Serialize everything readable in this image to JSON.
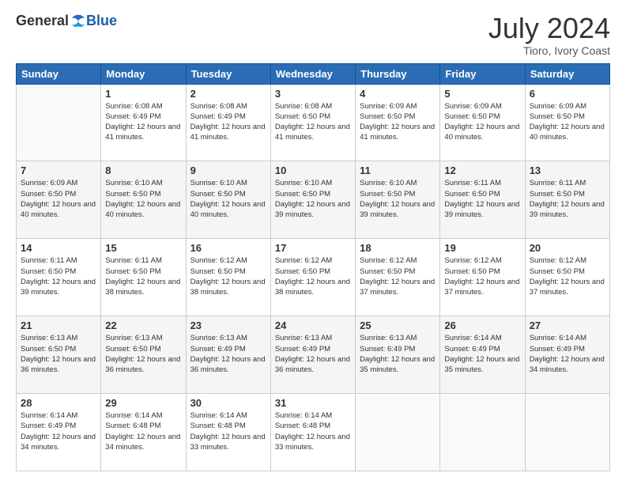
{
  "header": {
    "logo_general": "General",
    "logo_blue": "Blue",
    "month_title": "July 2024",
    "subtitle": "Tioro, Ivory Coast"
  },
  "calendar": {
    "days_of_week": [
      "Sunday",
      "Monday",
      "Tuesday",
      "Wednesday",
      "Thursday",
      "Friday",
      "Saturday"
    ],
    "weeks": [
      [
        {
          "day": "",
          "info": ""
        },
        {
          "day": "1",
          "info": "Sunrise: 6:08 AM\nSunset: 6:49 PM\nDaylight: 12 hours\nand 41 minutes."
        },
        {
          "day": "2",
          "info": "Sunrise: 6:08 AM\nSunset: 6:49 PM\nDaylight: 12 hours\nand 41 minutes."
        },
        {
          "day": "3",
          "info": "Sunrise: 6:08 AM\nSunset: 6:50 PM\nDaylight: 12 hours\nand 41 minutes."
        },
        {
          "day": "4",
          "info": "Sunrise: 6:09 AM\nSunset: 6:50 PM\nDaylight: 12 hours\nand 41 minutes."
        },
        {
          "day": "5",
          "info": "Sunrise: 6:09 AM\nSunset: 6:50 PM\nDaylight: 12 hours\nand 40 minutes."
        },
        {
          "day": "6",
          "info": "Sunrise: 6:09 AM\nSunset: 6:50 PM\nDaylight: 12 hours\nand 40 minutes."
        }
      ],
      [
        {
          "day": "7",
          "info": "Sunrise: 6:09 AM\nSunset: 6:50 PM\nDaylight: 12 hours\nand 40 minutes."
        },
        {
          "day": "8",
          "info": "Sunrise: 6:10 AM\nSunset: 6:50 PM\nDaylight: 12 hours\nand 40 minutes."
        },
        {
          "day": "9",
          "info": "Sunrise: 6:10 AM\nSunset: 6:50 PM\nDaylight: 12 hours\nand 40 minutes."
        },
        {
          "day": "10",
          "info": "Sunrise: 6:10 AM\nSunset: 6:50 PM\nDaylight: 12 hours\nand 39 minutes."
        },
        {
          "day": "11",
          "info": "Sunrise: 6:10 AM\nSunset: 6:50 PM\nDaylight: 12 hours\nand 39 minutes."
        },
        {
          "day": "12",
          "info": "Sunrise: 6:11 AM\nSunset: 6:50 PM\nDaylight: 12 hours\nand 39 minutes."
        },
        {
          "day": "13",
          "info": "Sunrise: 6:11 AM\nSunset: 6:50 PM\nDaylight: 12 hours\nand 39 minutes."
        }
      ],
      [
        {
          "day": "14",
          "info": "Sunrise: 6:11 AM\nSunset: 6:50 PM\nDaylight: 12 hours\nand 39 minutes."
        },
        {
          "day": "15",
          "info": "Sunrise: 6:11 AM\nSunset: 6:50 PM\nDaylight: 12 hours\nand 38 minutes."
        },
        {
          "day": "16",
          "info": "Sunrise: 6:12 AM\nSunset: 6:50 PM\nDaylight: 12 hours\nand 38 minutes."
        },
        {
          "day": "17",
          "info": "Sunrise: 6:12 AM\nSunset: 6:50 PM\nDaylight: 12 hours\nand 38 minutes."
        },
        {
          "day": "18",
          "info": "Sunrise: 6:12 AM\nSunset: 6:50 PM\nDaylight: 12 hours\nand 37 minutes."
        },
        {
          "day": "19",
          "info": "Sunrise: 6:12 AM\nSunset: 6:50 PM\nDaylight: 12 hours\nand 37 minutes."
        },
        {
          "day": "20",
          "info": "Sunrise: 6:12 AM\nSunset: 6:50 PM\nDaylight: 12 hours\nand 37 minutes."
        }
      ],
      [
        {
          "day": "21",
          "info": "Sunrise: 6:13 AM\nSunset: 6:50 PM\nDaylight: 12 hours\nand 36 minutes."
        },
        {
          "day": "22",
          "info": "Sunrise: 6:13 AM\nSunset: 6:50 PM\nDaylight: 12 hours\nand 36 minutes."
        },
        {
          "day": "23",
          "info": "Sunrise: 6:13 AM\nSunset: 6:49 PM\nDaylight: 12 hours\nand 36 minutes."
        },
        {
          "day": "24",
          "info": "Sunrise: 6:13 AM\nSunset: 6:49 PM\nDaylight: 12 hours\nand 36 minutes."
        },
        {
          "day": "25",
          "info": "Sunrise: 6:13 AM\nSunset: 6:49 PM\nDaylight: 12 hours\nand 35 minutes."
        },
        {
          "day": "26",
          "info": "Sunrise: 6:14 AM\nSunset: 6:49 PM\nDaylight: 12 hours\nand 35 minutes."
        },
        {
          "day": "27",
          "info": "Sunrise: 6:14 AM\nSunset: 6:49 PM\nDaylight: 12 hours\nand 34 minutes."
        }
      ],
      [
        {
          "day": "28",
          "info": "Sunrise: 6:14 AM\nSunset: 6:49 PM\nDaylight: 12 hours\nand 34 minutes."
        },
        {
          "day": "29",
          "info": "Sunrise: 6:14 AM\nSunset: 6:48 PM\nDaylight: 12 hours\nand 34 minutes."
        },
        {
          "day": "30",
          "info": "Sunrise: 6:14 AM\nSunset: 6:48 PM\nDaylight: 12 hours\nand 33 minutes."
        },
        {
          "day": "31",
          "info": "Sunrise: 6:14 AM\nSunset: 6:48 PM\nDaylight: 12 hours\nand 33 minutes."
        },
        {
          "day": "",
          "info": ""
        },
        {
          "day": "",
          "info": ""
        },
        {
          "day": "",
          "info": ""
        }
      ]
    ]
  }
}
